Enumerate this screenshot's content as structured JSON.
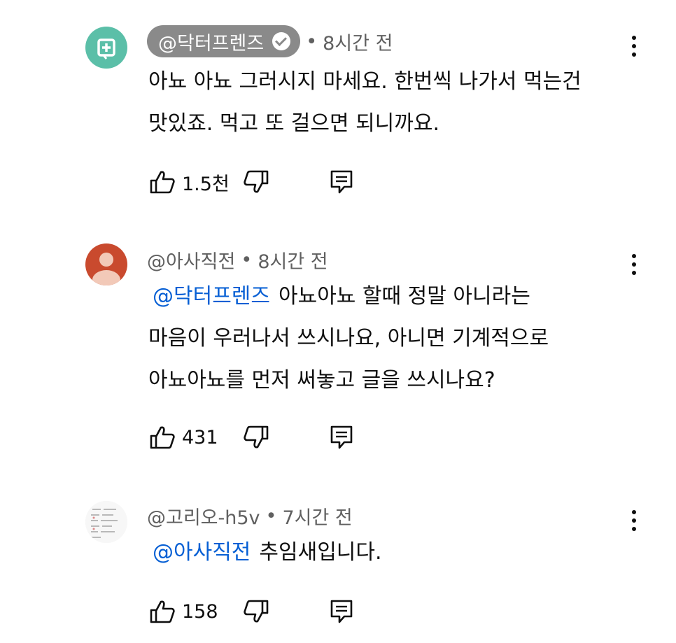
{
  "comments": [
    {
      "author": "@닥터프렌즈",
      "verified": true,
      "time": "8시간 전",
      "mention": "",
      "text": "아뇨 아뇨 그러시지 마세요. 한번씩 나가서 먹는건\n맛있죠. 먹고 또 걸으면 되니까요.",
      "likes": "1.5천",
      "avatar_color": "#5bbfa8",
      "avatar_icon": "plus-square-icon"
    },
    {
      "author": "@아사직전",
      "verified": false,
      "time": "8시간 전",
      "mention": "@닥터프렌즈",
      "text": "아뇨아뇨 할때 정말 아니라는\n마음이 우러나서 쓰시나요, 아니면 기계적으로\n아뇨아뇨를 먼저 써놓고 글을 쓰시나요?",
      "likes": "431",
      "avatar_color": "#c94a2e",
      "avatar_icon": "person-icon"
    },
    {
      "author": "@고리오-h5v",
      "verified": false,
      "time": "7시간 전",
      "mention": "@아사직전",
      "text": "추임새입니다.",
      "likes": "158",
      "avatar_color": "#f2f2f2",
      "avatar_icon": "document-thumbnail-icon"
    }
  ],
  "colors": {
    "mention": "#065fd4",
    "meta": "#606060",
    "chip": "#8a8a8a"
  }
}
